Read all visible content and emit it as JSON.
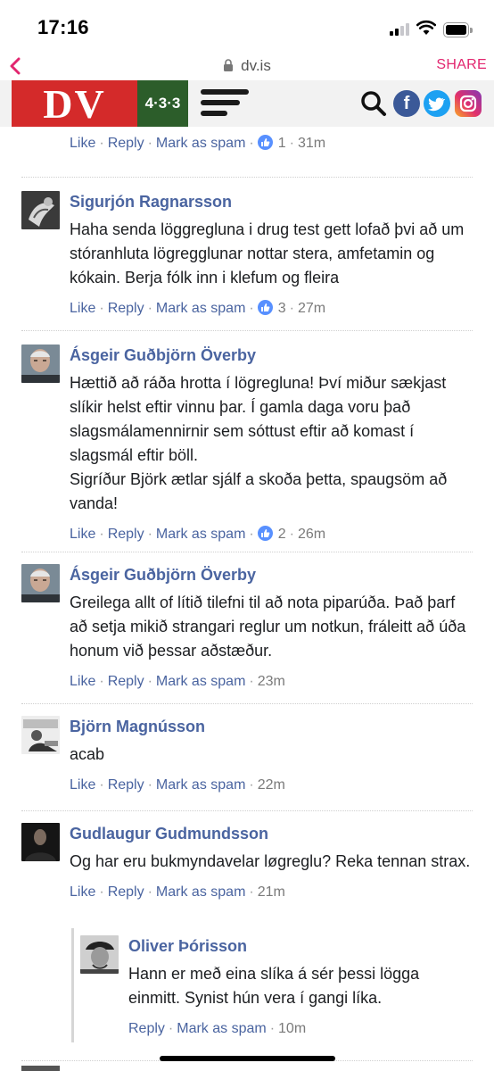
{
  "status": {
    "time": "17:16"
  },
  "browser": {
    "url": "dv.is",
    "share": "SHARE"
  },
  "header": {
    "logo_dv": "DV",
    "logo_433": "4·3·3"
  },
  "icons": {
    "search": "search-icon",
    "facebook": "facebook-icon",
    "twitter": "twitter-icon",
    "instagram": "instagram-icon",
    "menu": "menu-icon"
  },
  "colors": {
    "dv_red": "#d42a2a",
    "green": "#2c5d2a",
    "link": "#4a64a0",
    "share_pink": "#e2266f"
  },
  "actions": {
    "like": "Like",
    "reply": "Reply",
    "spam": "Mark as spam"
  },
  "comments": [
    {
      "author": "",
      "text": "...",
      "likes": "1",
      "time": "31m"
    },
    {
      "author": "Sigurjón Ragnarsson",
      "text": "Haha senda löggregluna i drug test gett lofað þvi að um stóranhluta lögregglunar nottar stera, amfetamin og kókain. Berja fólk inn i klefum og fleira",
      "likes": "3",
      "time": "27m"
    },
    {
      "author": "Ásgeir Guðbjörn Överby",
      "text": "Hættið að ráða hrotta í lögregluna! Því miður sækjast slíkir helst eftir vinnu þar. Í gamla daga voru það slagsmálamennirnir sem sóttust eftir að komast í slagsmál eftir böll.\nSigríður Björk ætlar sjálf a skoða þetta, spaugsöm að vanda!",
      "likes": "2",
      "time": "26m"
    },
    {
      "author": "Ásgeir Guðbjörn Överby",
      "text": "Greilega allt of lítið tilefni til að nota piparúða. Það þarf að setja mikið strangari reglur um notkun, fráleitt að úða honum við þessar aðstæður.",
      "time": "23m"
    },
    {
      "author": "Björn Magnússon",
      "text": "acab",
      "time": "22m"
    },
    {
      "author": "Gudlaugur Gudmundsson",
      "text": "Og har eru bukmyndavelar løgreglu? Reka tennan strax.",
      "time": "21m"
    }
  ],
  "reply": {
    "author": "Oliver Þórisson",
    "text": "Hann er með eina slíka á sér þessi lögga einmitt. Synist hún vera í gangi líka.",
    "time": "10m"
  }
}
